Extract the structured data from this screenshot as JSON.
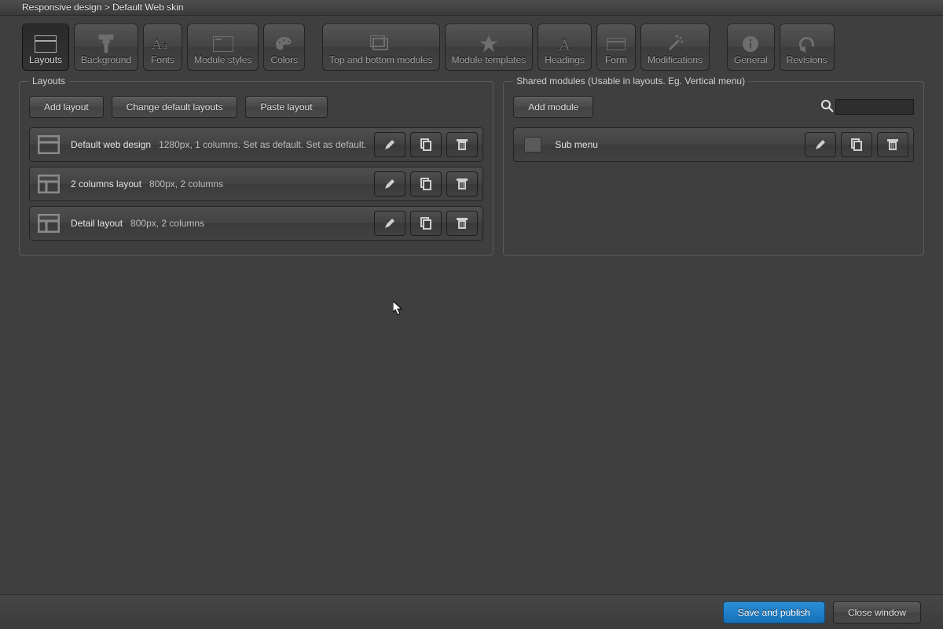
{
  "titlebar": "Responsive design > Default Web skin",
  "toolbar": {
    "layouts": "Layouts",
    "background": "Background",
    "fonts": "Fonts",
    "module_styles": "Module styles",
    "colors": "Colors",
    "top_bottom": "Top and bottom modules",
    "module_templates": "Module templates",
    "headings": "Headings",
    "form": "Form",
    "modifications": "Modifications",
    "general": "General",
    "revisions": "Revisions"
  },
  "layouts_panel": {
    "legend": "Layouts",
    "add": "Add layout",
    "change": "Change default layouts",
    "paste": "Paste layout",
    "rows": [
      {
        "name": "Default web design",
        "meta": "1280px, 1 columns. Set as default. Set as default."
      },
      {
        "name": "2 columns layout",
        "meta": "800px, 2 columns"
      },
      {
        "name": "Detail layout",
        "meta": "800px, 2 columns"
      }
    ]
  },
  "shared_panel": {
    "legend": "Shared modules (Usable in layouts. Eg. Vertical menu)",
    "add": "Add module",
    "rows": [
      {
        "name": "Sub menu"
      }
    ]
  },
  "footer": {
    "save": "Save and publish",
    "close": "Close window"
  }
}
